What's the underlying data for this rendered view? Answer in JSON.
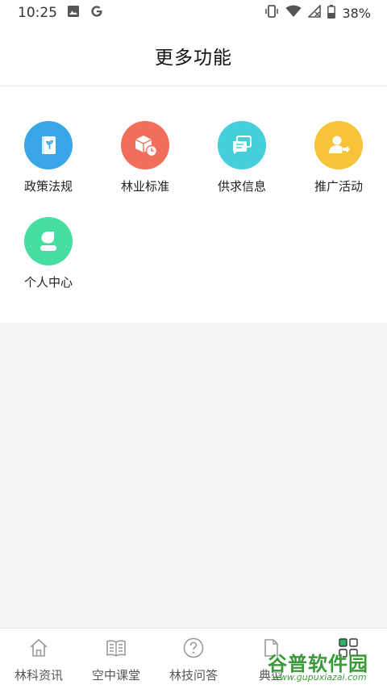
{
  "status_bar": {
    "time": "10:25",
    "battery": "38%"
  },
  "header": {
    "title": "更多功能"
  },
  "functions": [
    {
      "label": "政策法规",
      "icon": "policy-book-icon",
      "color": "#3aa6ea"
    },
    {
      "label": "林业标准",
      "icon": "standard-box-clock-icon",
      "color": "#f06e5b"
    },
    {
      "label": "供求信息",
      "icon": "supply-chat-icon",
      "color": "#45cfd8"
    },
    {
      "label": "推广活动",
      "icon": "promotion-user-icon",
      "color": "#f8c338"
    },
    {
      "label": "个人中心",
      "icon": "personal-center-icon",
      "color": "#46dea0"
    }
  ],
  "tabs": [
    {
      "label": "林科资讯",
      "icon": "home-icon"
    },
    {
      "label": "空中课堂",
      "icon": "book-icon"
    },
    {
      "label": "林技问答",
      "icon": "question-icon"
    },
    {
      "label": "典型",
      "icon": "document-icon"
    },
    {
      "label": "",
      "icon": "grid-apps-icon"
    }
  ],
  "watermark": {
    "main": "谷普软件园",
    "url": "www.gupuxiazai.com"
  }
}
